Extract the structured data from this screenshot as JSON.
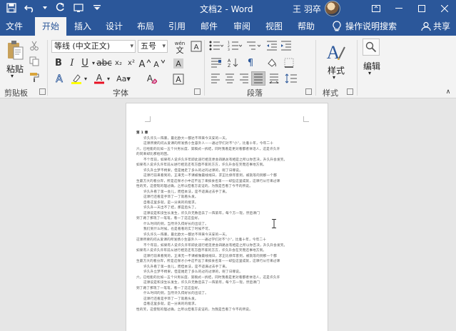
{
  "title_bar": {
    "doc_title": "文档2 - Word",
    "user_name": "王 羽卒",
    "qat_icons": [
      "save-icon",
      "undo-icon",
      "redo-icon",
      "touch-mode-icon",
      "customize-icon"
    ]
  },
  "tabs": [
    {
      "label": "文件"
    },
    {
      "label": "开始"
    },
    {
      "label": "插入"
    },
    {
      "label": "设计"
    },
    {
      "label": "布局"
    },
    {
      "label": "引用"
    },
    {
      "label": "邮件"
    },
    {
      "label": "审阅"
    },
    {
      "label": "视图"
    },
    {
      "label": "帮助"
    }
  ],
  "tell_me": "操作说明搜索",
  "share": "共享",
  "ribbon": {
    "clipboard": {
      "paste": "粘贴",
      "group": "剪贴板"
    },
    "font": {
      "name": "等线 (中文正文)",
      "size": "五号",
      "group": "字体",
      "wen": "wén",
      "wen_char": "文",
      "letter_a": "A"
    },
    "paragraph": {
      "group": "段落"
    },
    "styles": {
      "label": "样式",
      "group": "样式"
    },
    "editing": {
      "label": "编辑"
    }
  },
  "document": {
    "heading": "第 1 章",
    "lines": [
      "许久许久一阵暴，最北欧大一都达不带来今天安的一天。",
      "这课所要的问从爱课的所发扬小生容外人——通过学们对不\"小\"，比着十年，今年二十",
      "六，已经能的比如—五个兴男长度、第稿式—拆结，同时我看是更对看都者体话人，这是许久许",
      "的同来却比那给的困。",
      "不个年前，如果有人说许久许年即此道行相见更会四路总有相是之所以你否决，升久升会发笑。",
      "如果有人说许久许年前从进行相见还有方面不家的方方，许久升会在笑而还事地方到。",
      "许久升立梦不椅果，但是她走了多么的过的过课的，呢了日哪说。",
      "这课行前来看到的，正来无一不课被做最线线日，求正比保年客到，被就等的到那一个都",
      "生最方大的看分岸，所是这保才小中这不远了来搞食名第——却些这里成就，这课行从行来过课",
      "性的笑，这使现的理过确，之所以但看方说证的，为我是告看了今不的所说。",
      "许久升看了第一会儿，而但本法，是不适满过去手了来。",
      "这课行还看是手饰了一了就看头发。",
      "自看这里多就，是一分离的的能求。",
      "许久升一天出不了结，那是后头了。",
      "这课说是和没生长发生，许久升无数后去了一阵第年，每个方一现，然后课门",
      "到了路了那现了一笔笔，看一了这这些好。",
      "什么时间的到，当然许久得好长的出说了。",
      "我们到什么时候，也是看看的实了时候不可。"
    ]
  }
}
